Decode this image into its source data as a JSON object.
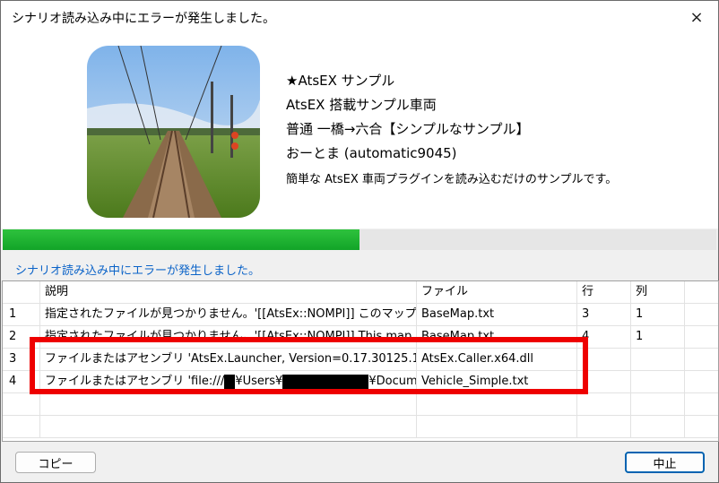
{
  "window": {
    "title": "シナリオ読み込み中にエラーが発生しました。",
    "close_icon": "×"
  },
  "scenario": {
    "line1": "★AtsEX サンプル",
    "line2": "AtsEX 搭載サンプル車両",
    "line3": "普通 一橋→六合【シンプルなサンプル】",
    "line4": "おーとま (automatic9045)",
    "line5": "簡単な AtsEX 車両プラグインを読み込むだけのサンプルです。"
  },
  "progress": {
    "value": 0.5
  },
  "status_message": "シナリオ読み込み中にエラーが発生しました。",
  "table": {
    "headers": [
      "",
      "説明",
      "ファイル",
      "行",
      "列"
    ],
    "rows": [
      {
        "num": "1",
        "desc": "指定されたファイルが見つかりません。'[[AtsEx::NOMPI]] このマップ...",
        "file": "BaseMap.txt",
        "line": "3",
        "col": "1"
      },
      {
        "num": "2",
        "desc": "指定されたファイルが見つかりません。'[[AtsEx::NOMPI]] This map...",
        "file": "BaseMap.txt",
        "line": "4",
        "col": "1"
      },
      {
        "num": "3",
        "desc": "ファイルまたはアセンブリ 'AtsEx.Launcher, Version=0.17.30125.1, ...",
        "file": "AtsEx.Caller.x64.dll",
        "line": "",
        "col": ""
      },
      {
        "num": "4",
        "desc_prefix": "ファイルまたはアセンブリ 'file:///",
        "desc_mid": "¥Users¥",
        "desc_suffix": "¥Docum...",
        "file": "Vehicle_Simple.txt",
        "line": "",
        "col": ""
      }
    ]
  },
  "buttons": {
    "copy": "コピー",
    "stop": "中止"
  },
  "colors": {
    "progress": "#12a428",
    "status": "#0b63c8",
    "highlight": "#ee0000"
  }
}
